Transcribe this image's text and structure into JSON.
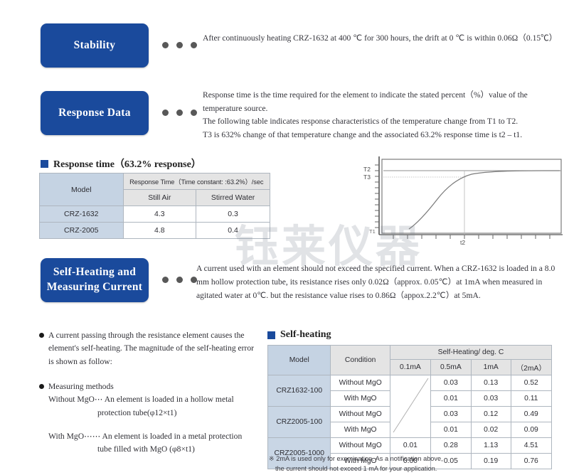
{
  "watermark": "钰莱仪器",
  "sections": {
    "stability": {
      "label": "Stability",
      "body": "After continuously heating CRZ-1632 at 400 ℃ for 300 hours, the drift at 0 ℃ is within 0.06Ω（0.15℃）"
    },
    "response_data": {
      "label": "Response Data",
      "body_line1": "Response time is the time required for the element to indicate the stated percent（%）value of the temperature source.",
      "body_line2": "The following table indicates response characteristics of the temperature change from T1 to T2.",
      "body_line3": "T3 is 632% change of that temperature change and the associated 63.2% response time is t2 – t1."
    },
    "self_heating": {
      "label_line1": "Self-Heating and",
      "label_line2": "Measuring Current",
      "body": "A current used with an element should not exceed the specified current. When a CRZ-1632 is loaded in a 8.0 mm hollow protection tube, its resistance rises only 0.02Ω（approx. 0.05℃）at 1mA when measured in agitated water at 0℃. but the resistance value rises to 0.86Ω（appox.2.2℃）at 5mA."
    }
  },
  "response_time": {
    "heading": "Response time（63.2% response）",
    "table": {
      "model_header": "Model",
      "group_header": "Response Time（Time constant: :63.2%）/sec",
      "sub_headers": [
        "Still Air",
        "Stirred Water"
      ],
      "rows": [
        {
          "model": "CRZ-1632",
          "still_air": "4.3",
          "stirred_water": "0.3"
        },
        {
          "model": "CRZ-2005",
          "still_air": "4.8",
          "stirred_water": "0.4"
        }
      ]
    }
  },
  "chart_data": {
    "type": "line",
    "title": "",
    "xlabel": "",
    "ylabel": "",
    "y_tick_labels": [
      "T2",
      "T3",
      "T1"
    ],
    "x_tick_labels": [
      "t2"
    ],
    "annotations": [
      "T2",
      "T3",
      "T1",
      "t2"
    ],
    "grid": false,
    "series": [
      {
        "name": "temperature response",
        "description": "exponential rise from T1 to asymptote T2",
        "x": [
          0,
          0.5,
          1,
          1.5,
          2,
          2.5,
          3,
          3.5,
          4,
          4.5,
          5,
          6,
          7,
          8,
          9,
          10
        ],
        "y": [
          0,
          0.18,
          0.34,
          0.47,
          0.57,
          0.66,
          0.73,
          0.78,
          0.83,
          0.86,
          0.89,
          0.94,
          0.96,
          0.98,
          0.99,
          1.0
        ]
      }
    ],
    "reference_lines": [
      {
        "axis": "y",
        "value": 1.0,
        "label": "T2"
      },
      {
        "axis": "y",
        "value": 0.632,
        "label": "T3"
      },
      {
        "axis": "x",
        "value": 4.0,
        "label": "t2"
      }
    ]
  },
  "notes": {
    "bullet1": "A current passing through the resistance element causes the element's self-heating. The magnitude of the self-heating error is shown as follow:",
    "bullet2": "Measuring methods",
    "without_mgo_line1": "Without MgO⋯ An element is loaded in a hollow metal",
    "without_mgo_line2": "protection tube(φ12×t1)",
    "with_mgo_line1": "With MgO⋯⋯ An element is loaded in a metal protection",
    "with_mgo_line2": "tube filled with MgO (φ8×t1)"
  },
  "self_heating_table": {
    "heading": "Self-heating",
    "model_header": "Model",
    "condition_header": "Condition",
    "group_header": "Self-Heating/ deg. C",
    "current_headers": [
      "0.1mA",
      "0.5mA",
      "1mA",
      "（2mA）"
    ],
    "rows": [
      {
        "model": "CRZ1632-100",
        "condition": "Without MgO",
        "c01": "",
        "c05": "0.03",
        "c1": "0.13",
        "c2": "0.52"
      },
      {
        "model": "CRZ1632-100",
        "condition": "With MgO",
        "c01": "",
        "c05": "0.01",
        "c1": "0.03",
        "c2": "0.11"
      },
      {
        "model": "CRZ2005-100",
        "condition": "Without MgO",
        "c01": "",
        "c05": "0.03",
        "c1": "0.12",
        "c2": "0.49"
      },
      {
        "model": "CRZ2005-100",
        "condition": "With MgO",
        "c01": "",
        "c05": "0.01",
        "c1": "0.02",
        "c2": "0.09"
      },
      {
        "model": "CRZ2005-1000",
        "condition": "Without MgO",
        "c01": "0.01",
        "c05": "0.28",
        "c1": "1.13",
        "c2": "4.51"
      },
      {
        "model": "CRZ2005-1000",
        "condition": "With MgO",
        "c01": "0.00",
        "c05": "0.05",
        "c1": "0.19",
        "c2": "0.76"
      }
    ],
    "footnote_line1": "※ 2mA is used only for examination. As a notification above,",
    "footnote_line2": "the current should not exceed 1 mA for your application."
  },
  "colors": {
    "brand_blue": "#1a4a9c",
    "model_header_blue": "#c5d3e3",
    "gray_header": "#e4e4e4"
  }
}
